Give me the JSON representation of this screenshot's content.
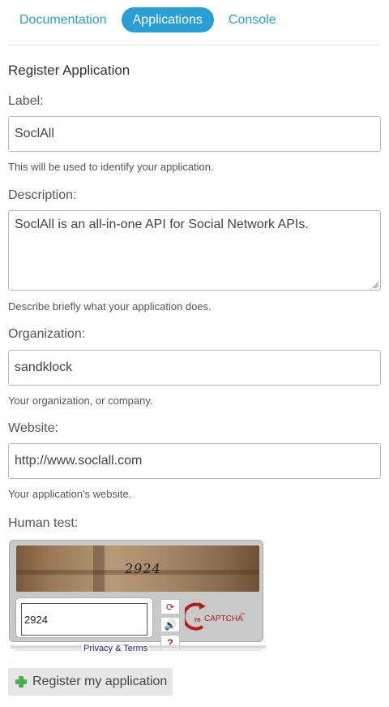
{
  "nav": {
    "tabs": [
      {
        "label": "Documentation",
        "active": false
      },
      {
        "label": "Applications",
        "active": true
      },
      {
        "label": "Console",
        "active": false
      }
    ]
  },
  "page_title": "Register Application",
  "form": {
    "label": {
      "label": "Label:",
      "value": "SoclAll",
      "help": "This will be used to identify your application."
    },
    "description": {
      "label": "Description:",
      "value": "SoclAll is an all-in-one API for Social Network APIs.",
      "help": "Describe briefly what your application does."
    },
    "organization": {
      "label": "Organization:",
      "value": "sandklock",
      "help": "Your organization, or company."
    },
    "website": {
      "label": "Website:",
      "value": "http://www.soclall.com",
      "help": "Your application's website."
    },
    "human_test": {
      "label": "Human test:",
      "captcha_word": "2924",
      "captcha_answer": "2924",
      "privacy_link": "Privacy & Terms",
      "logo_prefix": "re",
      "logo_text": "CAPTCHA",
      "logo_tm": "™",
      "controls": [
        {
          "icon": "refresh-icon",
          "glyph": "⟳"
        },
        {
          "icon": "audio-icon",
          "glyph": "🔊"
        },
        {
          "icon": "help-icon",
          "glyph": "?"
        }
      ]
    },
    "submit_label": "Register my application"
  },
  "colors": {
    "accent": "#2a9fd6",
    "captcha_red": "#b01e1e",
    "button_bg": "#e6e6e6"
  }
}
